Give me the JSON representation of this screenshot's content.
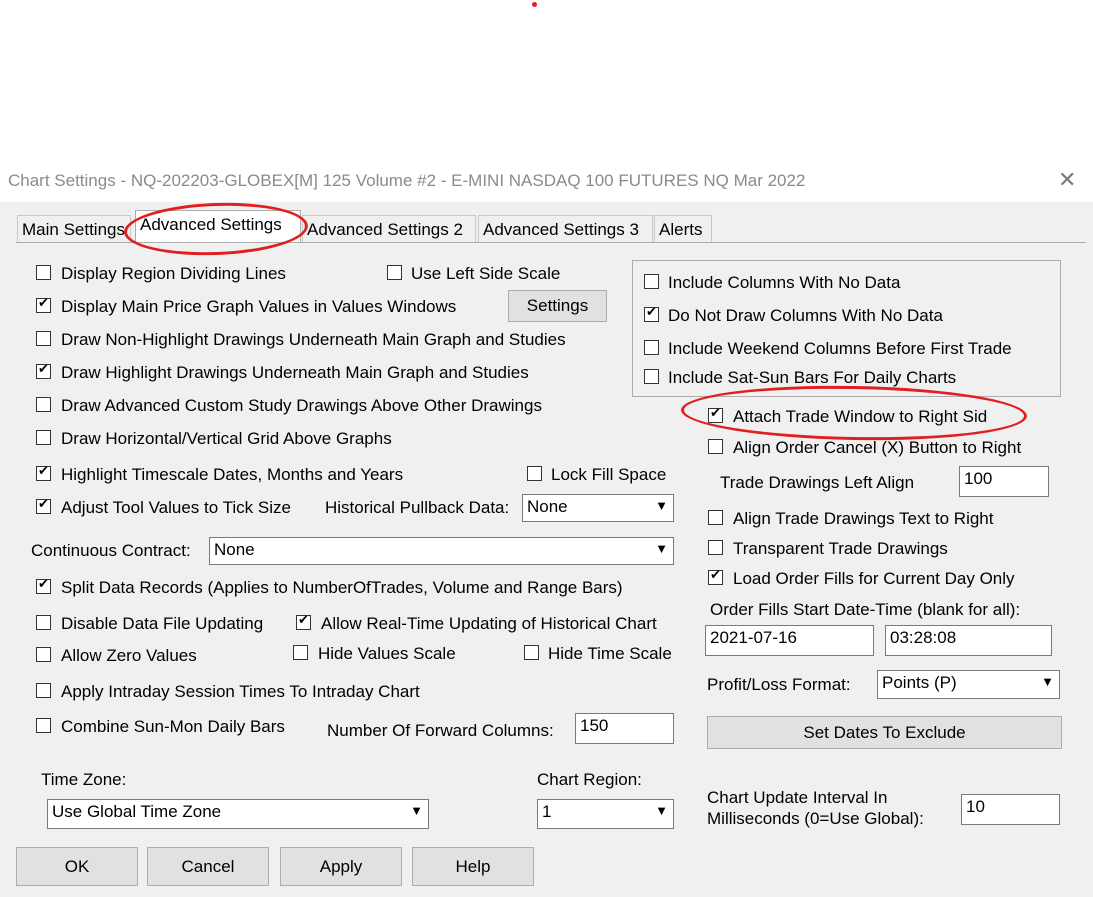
{
  "window": {
    "title": "Chart Settings - NQ-202203-GLOBEX[M]  125 Volume  #2 - E-MINI NASDAQ 100 FUTURES NQ Mar 2022",
    "close_icon": "close-icon"
  },
  "tabs": [
    "Main Settings",
    "Advanced Settings",
    "Advanced Settings 2",
    "Advanced Settings 3",
    "Alerts"
  ],
  "left": {
    "display_region_dividing_lines": "Display Region Dividing Lines",
    "use_left_side_scale": "Use Left Side Scale",
    "display_main_price_graph_values": "Display Main Price Graph Values in Values Windows",
    "settings_button": "Settings",
    "draw_non_highlight": "Draw Non-Highlight Drawings Underneath Main Graph and Studies",
    "draw_highlight": "Draw Highlight Drawings Underneath Main Graph and Studies",
    "draw_advanced_custom": "Draw Advanced Custom Study Drawings Above Other Drawings",
    "draw_grid_above": "Draw Horizontal/Vertical Grid Above Graphs",
    "highlight_timescale": "Highlight Timescale Dates, Months and Years",
    "lock_fill_space": "Lock Fill Space",
    "adjust_tool_values": "Adjust Tool Values to Tick Size",
    "historical_pullback_label": "Historical Pullback Data:",
    "historical_pullback_value": "None",
    "continuous_contract_label": "Continuous Contract:",
    "continuous_contract_value": "None",
    "split_data_records": "Split Data Records (Applies to NumberOfTrades, Volume and Range Bars)",
    "disable_data_file_updating": "Disable Data File Updating",
    "allow_realtime_updating": "Allow Real-Time Updating of Historical Chart",
    "allow_zero_values": "Allow Zero Values",
    "hide_values_scale": "Hide Values Scale",
    "hide_time_scale": "Hide Time Scale",
    "apply_intraday_session": "Apply Intraday Session Times To Intraday Chart",
    "combine_sun_mon": "Combine Sun-Mon Daily Bars",
    "forward_columns_label": "Number Of Forward Columns:",
    "forward_columns_value": "150",
    "time_zone_label": "Time Zone:",
    "time_zone_value": "Use Global Time Zone",
    "chart_region_label": "Chart Region:",
    "chart_region_value": "1"
  },
  "right": {
    "include_columns_no_data": "Include Columns With No Data",
    "do_not_draw_columns": "Do Not Draw Columns With No Data",
    "include_weekend_columns": "Include Weekend Columns Before First Trade",
    "include_sat_sun_bars": "Include Sat-Sun Bars For Daily Charts",
    "attach_trade_window": "Attach Trade Window to Right Sid",
    "align_order_cancel": "Align Order Cancel (X) Button to Right",
    "trade_drawings_left_align_label": "Trade Drawings Left Align",
    "trade_drawings_left_align_value": "100",
    "align_trade_drawings_text": "Align Trade Drawings Text to Right",
    "transparent_trade_drawings": "Transparent Trade Drawings",
    "load_order_fills": "Load Order Fills for Current Day Only",
    "order_fills_start_label": "Order Fills Start Date-Time (blank for all):",
    "order_fills_date": "2021-07-16",
    "order_fills_time": "03:28:08",
    "profit_loss_label": "Profit/Loss Format:",
    "profit_loss_value": "Points (P)",
    "set_dates_button": "Set Dates To Exclude",
    "chart_update_label_1": "Chart Update Interval In",
    "chart_update_label_2": "Milliseconds (0=Use Global):",
    "chart_update_value": "10"
  },
  "buttons": {
    "ok": "OK",
    "cancel": "Cancel",
    "apply": "Apply",
    "help": "Help"
  },
  "annotation_color": "#e02020"
}
